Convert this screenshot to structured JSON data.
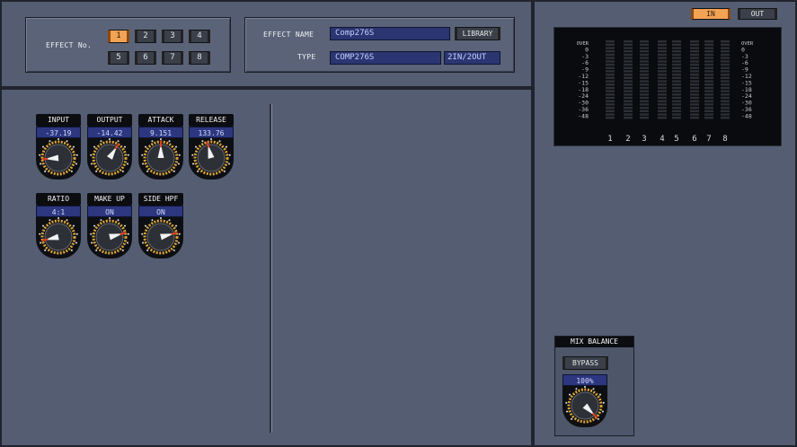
{
  "effect_no": {
    "label": "EFFECT No.",
    "buttons": [
      "1",
      "2",
      "3",
      "4",
      "5",
      "6",
      "7",
      "8"
    ],
    "selected": "1"
  },
  "effect_info": {
    "name_label": "EFFECT NAME",
    "name_value": "Comp276S",
    "library_label": "LIBRARY",
    "type_label": "TYPE",
    "type_value": "COMP276S",
    "io_label": "2IN/2OUT"
  },
  "params": [
    {
      "label": "INPUT",
      "value": "-37.19",
      "level": 0.15
    },
    {
      "label": "OUTPUT",
      "value": "-14.42",
      "level": 0.62
    },
    {
      "label": "ATTACK",
      "value": "9.151",
      "level": 0.5
    },
    {
      "label": "RELEASE",
      "value": "133.76",
      "level": 0.45
    },
    {
      "label": "RATIO",
      "value": "4:1",
      "level": 0.12
    },
    {
      "label": "MAKE UP",
      "value": "ON",
      "level": 0.78
    },
    {
      "label": "SIDE HPF",
      "value": "ON",
      "level": 0.78
    }
  ],
  "meter": {
    "scale": [
      "OVER",
      "0",
      "-3",
      "-6",
      "-9",
      "-12",
      "-15",
      "-18",
      "-24",
      "-30",
      "-36",
      "-48"
    ],
    "channels": [
      "1",
      "2",
      "3",
      "4",
      "5",
      "6",
      "7",
      "8"
    ]
  },
  "io_buttons": {
    "in": "IN",
    "out": "OUT",
    "selected": "in"
  },
  "mix_balance": {
    "title": "MIX BALANCE",
    "bypass_label": "BYPASS",
    "value": "100%",
    "level": 1.0
  },
  "colors": {
    "accent": "#f4a254",
    "field": "#2a3572",
    "panel": "#545d72",
    "knob_ring": "#d9a63a"
  }
}
